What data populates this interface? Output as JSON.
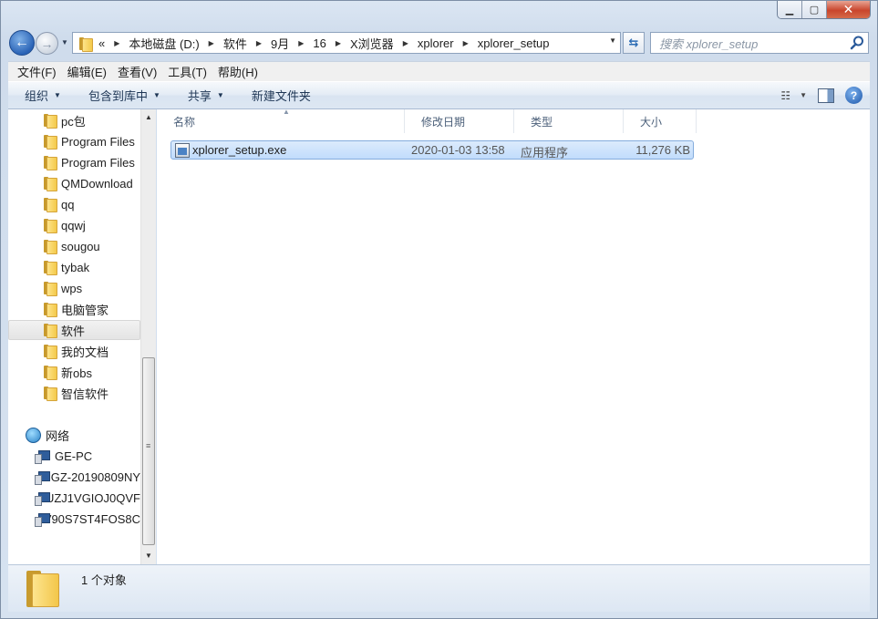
{
  "window": {
    "title": ""
  },
  "address": {
    "prefix": "«",
    "crumbs": [
      "本地磁盘 (D:)",
      "软件",
      "9月",
      "16",
      "X浏览器",
      "xplorer",
      "xplorer_setup"
    ]
  },
  "search": {
    "placeholder": "搜索 xplorer_setup"
  },
  "menu": [
    "文件(F)",
    "编辑(E)",
    "查看(V)",
    "工具(T)",
    "帮助(H)"
  ],
  "commands": {
    "organize": "组织",
    "include_in_library": "包含到库中",
    "share": "共享",
    "new_folder": "新建文件夹"
  },
  "nav_tree": {
    "folders": [
      "pc包",
      "Program Files",
      "Program Files",
      "QMDownload",
      "qq",
      "qqwj",
      "sougou",
      "tybak",
      "wps",
      "电脑管家",
      "软件",
      "我的文档",
      "新obs",
      "智信软件"
    ],
    "selected_folder": "软件",
    "network_label": "网络",
    "computers": [
      "GE-PC",
      "GZ-20190809NY",
      "UZJ1VGIOJ0QVF",
      "V90S7ST4FOS8C"
    ]
  },
  "columns": {
    "name": "名称",
    "date": "修改日期",
    "type": "类型",
    "size": "大小"
  },
  "files": [
    {
      "name": "xplorer_setup.exe",
      "date": "2020-01-03 13:58",
      "type": "应用程序",
      "size": "11,276 KB"
    }
  ],
  "status": {
    "count_text": "1 个对象"
  },
  "colors": {
    "selection": "#cce4fc",
    "accent": "#2a63b6",
    "close_button": "#c9452c"
  }
}
